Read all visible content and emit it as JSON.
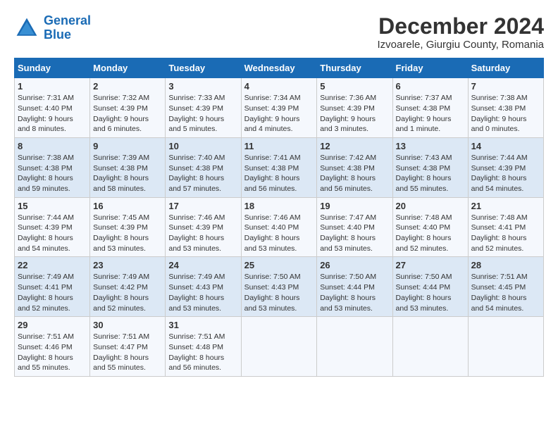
{
  "header": {
    "logo_line1": "General",
    "logo_line2": "Blue",
    "title": "December 2024",
    "subtitle": "Izvoarele, Giurgiu County, Romania"
  },
  "calendar": {
    "columns": [
      "Sunday",
      "Monday",
      "Tuesday",
      "Wednesday",
      "Thursday",
      "Friday",
      "Saturday"
    ],
    "weeks": [
      [
        null,
        null,
        null,
        null,
        null,
        null,
        null
      ]
    ],
    "days": {
      "1": {
        "sunrise": "7:31 AM",
        "sunset": "4:40 PM",
        "daylight": "9 hours and 8 minutes."
      },
      "2": {
        "sunrise": "7:32 AM",
        "sunset": "4:39 PM",
        "daylight": "9 hours and 6 minutes."
      },
      "3": {
        "sunrise": "7:33 AM",
        "sunset": "4:39 PM",
        "daylight": "9 hours and 5 minutes."
      },
      "4": {
        "sunrise": "7:34 AM",
        "sunset": "4:39 PM",
        "daylight": "9 hours and 4 minutes."
      },
      "5": {
        "sunrise": "7:36 AM",
        "sunset": "4:39 PM",
        "daylight": "9 hours and 3 minutes."
      },
      "6": {
        "sunrise": "7:37 AM",
        "sunset": "4:38 PM",
        "daylight": "9 hours and 1 minute."
      },
      "7": {
        "sunrise": "7:38 AM",
        "sunset": "4:38 PM",
        "daylight": "9 hours and 0 minutes."
      },
      "8": {
        "sunrise": "7:38 AM",
        "sunset": "4:38 PM",
        "daylight": "8 hours and 59 minutes."
      },
      "9": {
        "sunrise": "7:39 AM",
        "sunset": "4:38 PM",
        "daylight": "8 hours and 58 minutes."
      },
      "10": {
        "sunrise": "7:40 AM",
        "sunset": "4:38 PM",
        "daylight": "8 hours and 57 minutes."
      },
      "11": {
        "sunrise": "7:41 AM",
        "sunset": "4:38 PM",
        "daylight": "8 hours and 56 minutes."
      },
      "12": {
        "sunrise": "7:42 AM",
        "sunset": "4:38 PM",
        "daylight": "8 hours and 56 minutes."
      },
      "13": {
        "sunrise": "7:43 AM",
        "sunset": "4:38 PM",
        "daylight": "8 hours and 55 minutes."
      },
      "14": {
        "sunrise": "7:44 AM",
        "sunset": "4:39 PM",
        "daylight": "8 hours and 54 minutes."
      },
      "15": {
        "sunrise": "7:44 AM",
        "sunset": "4:39 PM",
        "daylight": "8 hours and 54 minutes."
      },
      "16": {
        "sunrise": "7:45 AM",
        "sunset": "4:39 PM",
        "daylight": "8 hours and 53 minutes."
      },
      "17": {
        "sunrise": "7:46 AM",
        "sunset": "4:39 PM",
        "daylight": "8 hours and 53 minutes."
      },
      "18": {
        "sunrise": "7:46 AM",
        "sunset": "4:40 PM",
        "daylight": "8 hours and 53 minutes."
      },
      "19": {
        "sunrise": "7:47 AM",
        "sunset": "4:40 PM",
        "daylight": "8 hours and 53 minutes."
      },
      "20": {
        "sunrise": "7:48 AM",
        "sunset": "4:40 PM",
        "daylight": "8 hours and 52 minutes."
      },
      "21": {
        "sunrise": "7:48 AM",
        "sunset": "4:41 PM",
        "daylight": "8 hours and 52 minutes."
      },
      "22": {
        "sunrise": "7:49 AM",
        "sunset": "4:41 PM",
        "daylight": "8 hours and 52 minutes."
      },
      "23": {
        "sunrise": "7:49 AM",
        "sunset": "4:42 PM",
        "daylight": "8 hours and 52 minutes."
      },
      "24": {
        "sunrise": "7:49 AM",
        "sunset": "4:43 PM",
        "daylight": "8 hours and 53 minutes."
      },
      "25": {
        "sunrise": "7:50 AM",
        "sunset": "4:43 PM",
        "daylight": "8 hours and 53 minutes."
      },
      "26": {
        "sunrise": "7:50 AM",
        "sunset": "4:44 PM",
        "daylight": "8 hours and 53 minutes."
      },
      "27": {
        "sunrise": "7:50 AM",
        "sunset": "4:44 PM",
        "daylight": "8 hours and 53 minutes."
      },
      "28": {
        "sunrise": "7:51 AM",
        "sunset": "4:45 PM",
        "daylight": "8 hours and 54 minutes."
      },
      "29": {
        "sunrise": "7:51 AM",
        "sunset": "4:46 PM",
        "daylight": "8 hours and 55 minutes."
      },
      "30": {
        "sunrise": "7:51 AM",
        "sunset": "4:47 PM",
        "daylight": "8 hours and 55 minutes."
      },
      "31": {
        "sunrise": "7:51 AM",
        "sunset": "4:48 PM",
        "daylight": "8 hours and 56 minutes."
      }
    }
  }
}
